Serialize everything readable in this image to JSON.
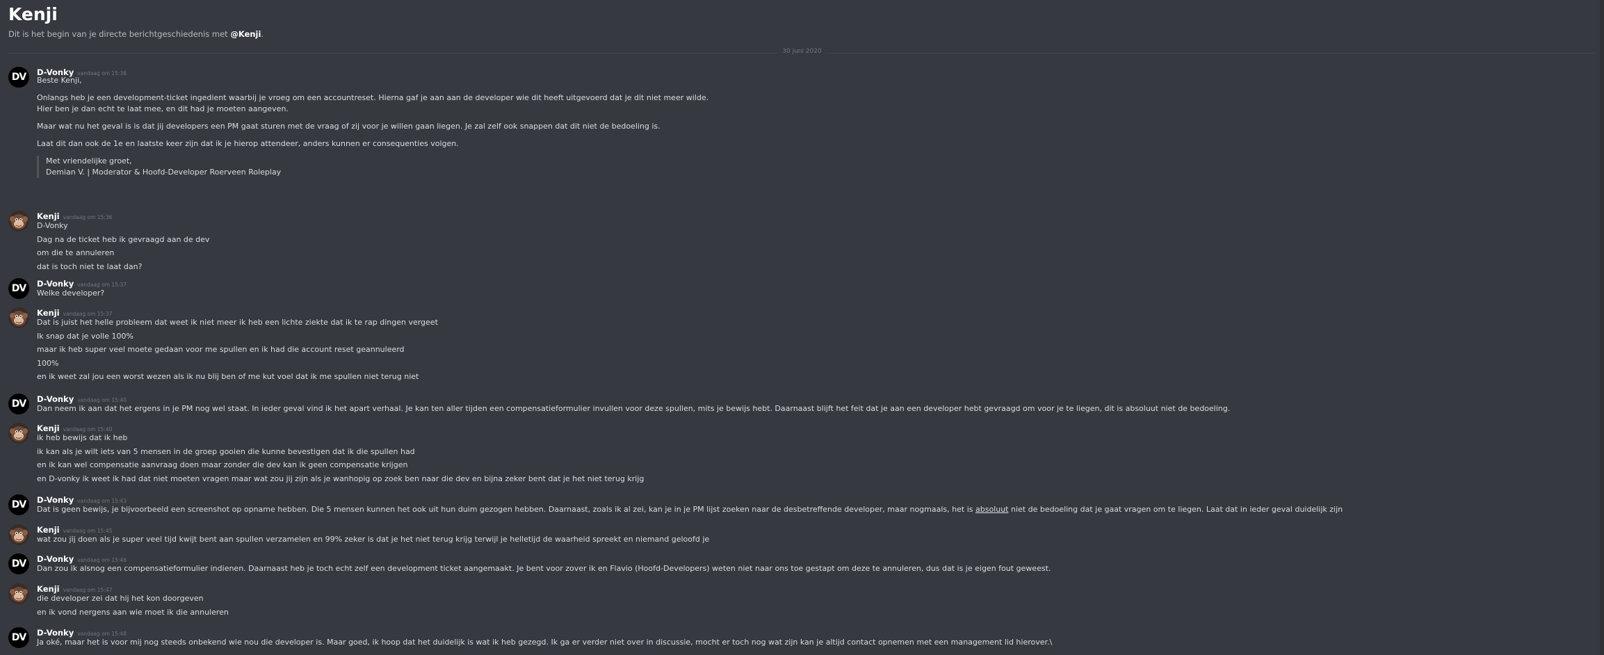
{
  "header": {
    "title": "Kenji",
    "subtitle_prefix": "Dit is het begin van je directe berichtgeschiedenis met ",
    "subtitle_mention": "@Kenji",
    "subtitle_suffix": "."
  },
  "date_divider": "30 juni 2020",
  "messages": [
    {
      "author": "D-Vonky",
      "timestamp": "vandaag om 15:36",
      "lines": [
        "Beste Kenji,",
        "",
        "Onlangs heb je een development-ticket ingedient waarbij je vroeg om een accountreset. Hierna gaf je aan aan de developer wie dit heeft uitgevoerd dat je dit niet meer wilde.",
        "Hier ben je dan echt te laat mee, en dit had je moeten aangeven.",
        "",
        "Maar wat nu het geval is is dat jij developers een PM gaat sturen met de vraag of zij voor je willen gaan liegen. Je zal zelf ook snappen dat dit niet de bedoeling is.",
        "",
        "Laat dit dan ook de 1e en laatste keer zijn dat ik je hierop attendeer, anders kunnen er consequenties volgen."
      ],
      "quote": [
        "Met vriendelijke groet,",
        "Demian V. | Moderator & Hoofd-Developer Roerveen Roleplay"
      ]
    },
    {
      "author": "Kenji",
      "timestamp": "vandaag om 15:36",
      "lines": [
        "D-Vonky",
        "Dag na de ticket heb ik gevraagd aan de dev",
        "om die te annuleren",
        "dat is toch niet te laat dan?"
      ]
    },
    {
      "author": "D-Vonky",
      "timestamp": "vandaag om 15:37",
      "lines": [
        "Welke developer?"
      ]
    },
    {
      "author": "Kenji",
      "timestamp": "vandaag om 15:37",
      "lines": [
        "Dat is juist het helle probleem dat weet ik niet meer ik heb een lichte ziekte dat ik te rap dingen vergeet",
        "Ik snap dat je volle 100%",
        "maar ik heb super veel moete gedaan voor me spullen en  ik had die account reset geannuleerd",
        "100%",
        "en ik weet zal jou een worst wezen als ik nu blij ben of me kut voel dat ik me spullen niet terug niet"
      ]
    },
    {
      "author": "D-Vonky",
      "timestamp": "vandaag om 15:40",
      "lines": [
        "Dan neem ik aan dat het ergens in je PM nog wel staat. In ieder geval vind ik het apart verhaal. Je kan ten aller tijden een compensatieformulier invullen voor deze spullen, mits je bewijs hebt. Daarnaast blijft het feit dat je aan een developer hebt gevraagd om voor je te liegen, dit is absoluut niet de bedoeling."
      ]
    },
    {
      "author": "Kenji",
      "timestamp": "vandaag om 15:40",
      "lines": [
        "ik heb bewijs dat ik heb",
        "ik kan als je wilt iets van 5 mensen in de groep gooien die kunne bevestigen dat ik die spullen had",
        "en ik kan wel compensatie aanvraag doen maar zonder die dev  kan ik geen compensatie krijgen",
        "en D-vonky ik weet ik had dat niet moeten vragen maar wat zou jij zijn als je  wanhopig op zoek ben naar die dev en bijna zeker bent dat je het niet terug krijg"
      ]
    },
    {
      "author": "D-Vonky",
      "timestamp": "vandaag om 15:43",
      "lines_rich": {
        "before": "Dat is geen bewijs, je bijvoorbeeld een screenshot op opname hebben. Die 5 mensen kunnen het ook uit hun duim gezogen hebben. Daarnaast, zoals ik al zei, kan je in je PM lijst zoeken naar de desbetreffende developer, maar nogmaals, het is ",
        "underlined": "absoluut",
        "after": " niet de bedoeling dat je gaat vragen om te liegen. Laat dat in ieder geval duidelijk zijn"
      }
    },
    {
      "author": "Kenji",
      "timestamp": "vandaag om 15:45",
      "lines": [
        "wat zou jij doen als je super veel tijd kwijt bent aan spullen verzamelen en  99% zeker is dat je het niet terug krijg terwijl je helletijd de waarheid spreekt en niemand geloofd je"
      ]
    },
    {
      "author": "D-Vonky",
      "timestamp": "vandaag om 15:46",
      "lines": [
        "Dan zou ik alsnog een compensatieformulier indienen. Daarnaast heb je toch echt zelf een development ticket aangemaakt. Je bent voor zover ik en Flavio (Hoofd-Developers) weten niet naar ons toe gestapt om deze te annuleren, dus dat is je eigen fout geweest."
      ]
    },
    {
      "author": "Kenji",
      "timestamp": "vandaag om 15:47",
      "lines": [
        "die developer zei dat hij het kon doorgeven",
        "en ik vond nergens aan wie moet ik  die annuleren"
      ]
    },
    {
      "author": "D-Vonky",
      "timestamp": "vandaag om 15:48",
      "lines": [
        "Ja oké, maar het is voor mij nog steeds onbekend wie nou die developer is. Maar goed, ik hoop dat het duidelijk is wat ik heb gezegd. Ik ga er verder niet over in discussie, mocht er toch nog wat zijn kan je altijd contact opnemen met een management lid hierover.\\"
      ]
    }
  ],
  "avatars": {
    "D-Vonky": {
      "initials": "DV",
      "background": "#000000"
    },
    "Kenji": {
      "icon": "monkey-avatar-icon",
      "background": "#4a3b34"
    }
  },
  "colors": {
    "background": "#36393f",
    "text": "#dcddde",
    "author": "#ffffff",
    "timestamp": "#72767d"
  }
}
